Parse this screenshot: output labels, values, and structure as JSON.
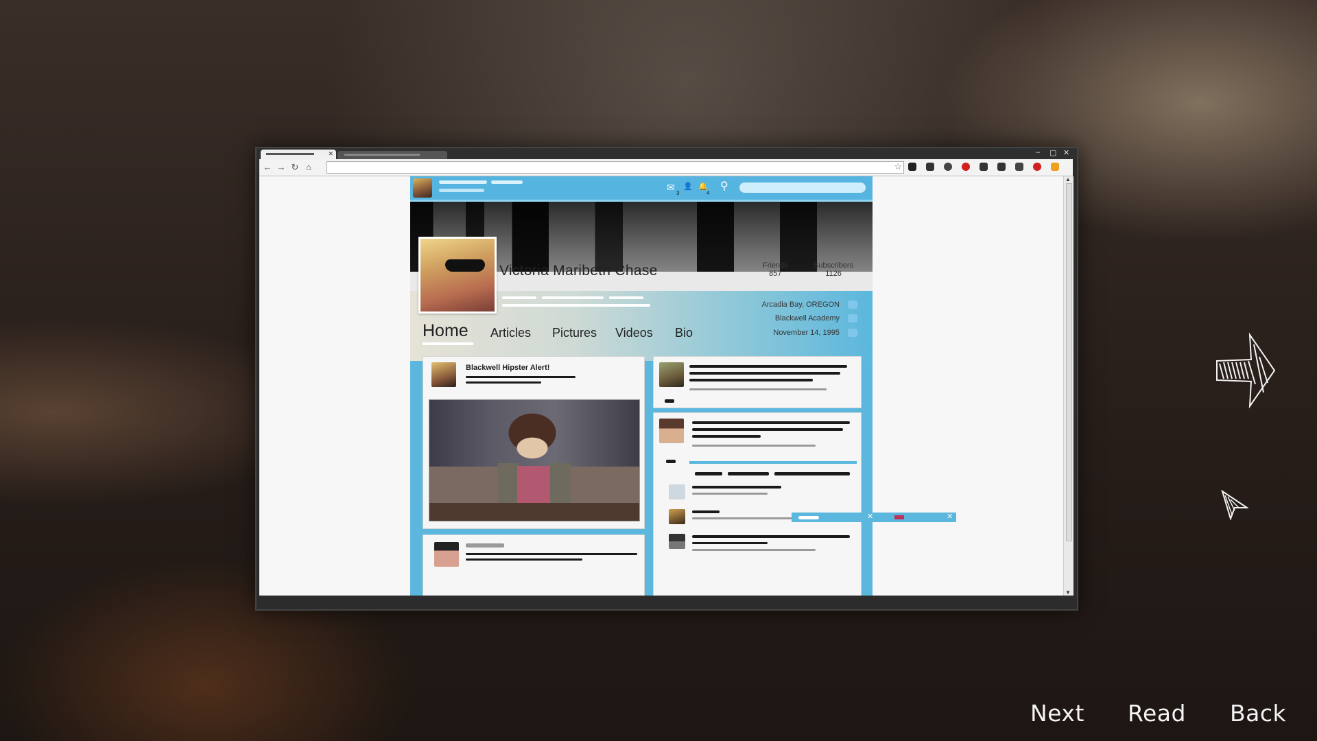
{
  "browser": {
    "window_controls": [
      "–",
      "▢",
      "✕"
    ],
    "tab_close": "✕",
    "nav": [
      "←",
      "→",
      "↻",
      "⌂"
    ],
    "bookmark_star": "☆",
    "extension_colors": [
      "#222222",
      "#333333",
      "#444444",
      "#d02020",
      "#333333",
      "#333333",
      "#444444",
      "#d02020",
      "#f0a020"
    ]
  },
  "site": {
    "top_bar": {
      "messages_count": "3",
      "notifications_count": "4",
      "messages_icon": "✉",
      "friends_icon": "👤",
      "notifications_icon": "🔔",
      "search_icon": "⚲"
    },
    "profile": {
      "name": "Victoria Maribeth Chase",
      "friends_label": "Friends",
      "friends_count": "857",
      "subscribers_label": "Subscribers",
      "subscribers_count": "1126",
      "location": "Arcadia Bay, OREGON",
      "school": "Blackwell Academy",
      "birthday": "November 14, 1995"
    },
    "tabs": [
      "Home",
      "Articles",
      "Pictures",
      "Videos",
      "Bio"
    ],
    "posts": [
      {
        "title": "Blackwell Hipster Alert!"
      }
    ]
  },
  "menu": {
    "next": "Next",
    "read": "Read",
    "back": "Back"
  },
  "colors": {
    "site_accent": "#5bb7dd",
    "menu_text": "#f4f4f4"
  }
}
